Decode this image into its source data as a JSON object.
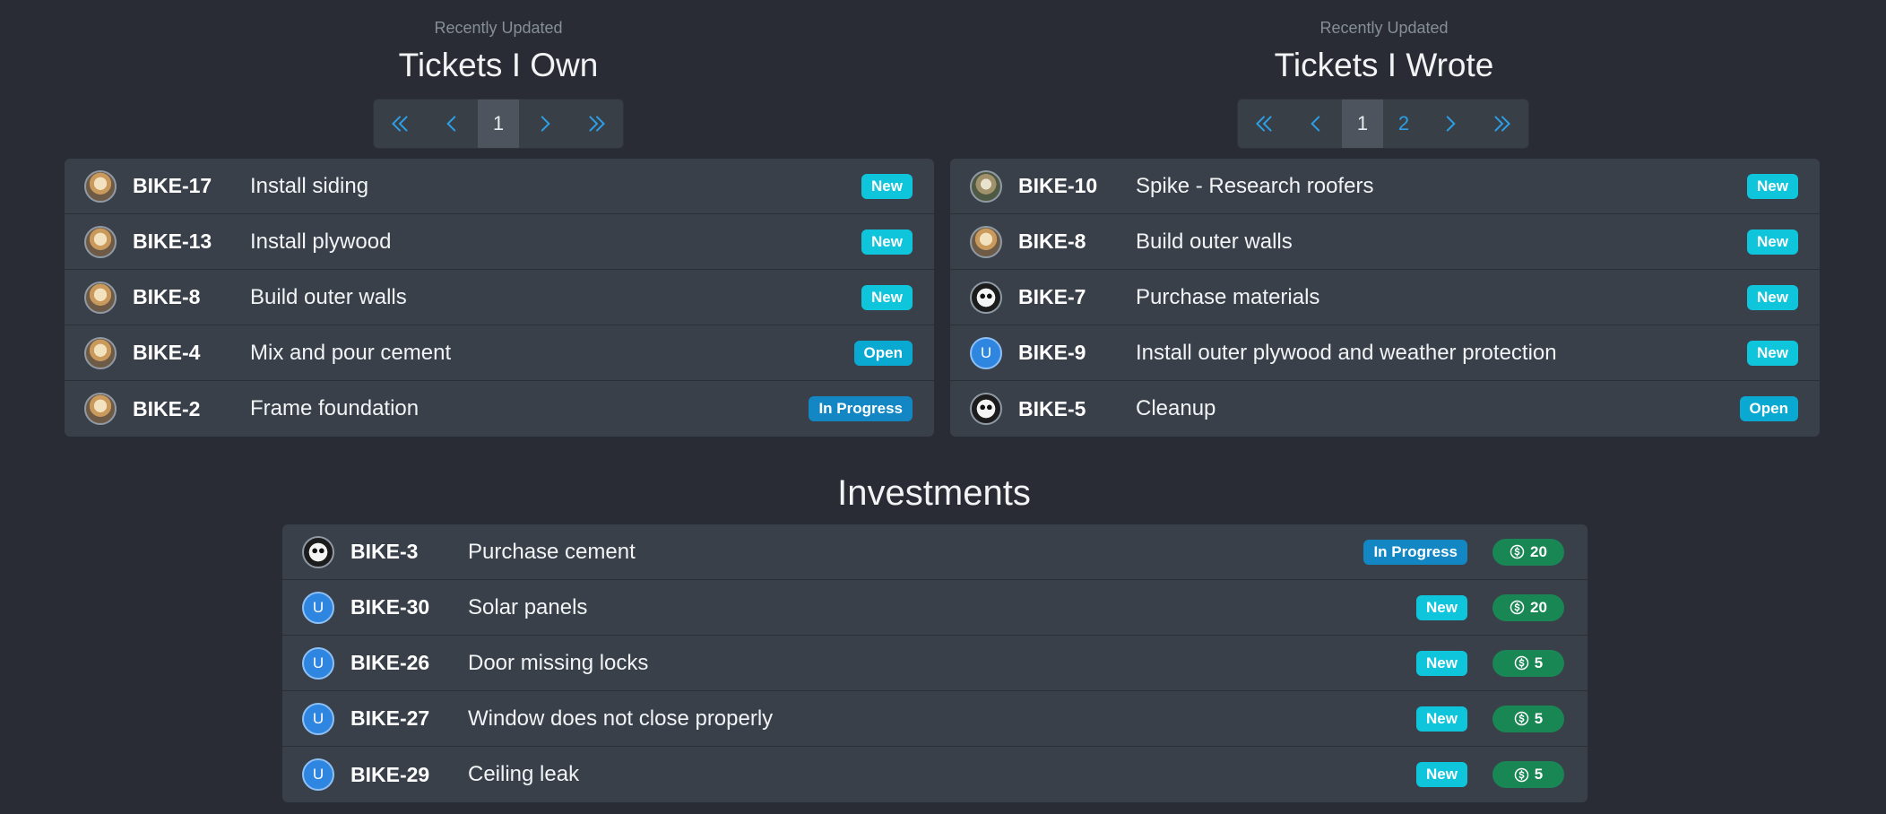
{
  "owned": {
    "subtitle": "Recently Updated",
    "title": "Tickets I Own",
    "pages": [
      "1"
    ],
    "tickets": [
      {
        "avatar": "dog",
        "key": "BIKE-17",
        "summary": "Install siding",
        "status": "New"
      },
      {
        "avatar": "dog",
        "key": "BIKE-13",
        "summary": "Install plywood",
        "status": "New"
      },
      {
        "avatar": "dog",
        "key": "BIKE-8",
        "summary": "Build outer walls",
        "status": "New"
      },
      {
        "avatar": "dog",
        "key": "BIKE-4",
        "summary": "Mix and pour cement",
        "status": "Open"
      },
      {
        "avatar": "dog",
        "key": "BIKE-2",
        "summary": "Frame foundation",
        "status": "In Progress"
      }
    ]
  },
  "wrote": {
    "subtitle": "Recently Updated",
    "title": "Tickets I Wrote",
    "pages": [
      "1",
      "2"
    ],
    "tickets": [
      {
        "avatar": "dog2",
        "key": "BIKE-10",
        "summary": "Spike - Research roofers",
        "status": "New"
      },
      {
        "avatar": "dog",
        "key": "BIKE-8",
        "summary": "Build outer walls",
        "status": "New"
      },
      {
        "avatar": "panda",
        "key": "BIKE-7",
        "summary": "Purchase materials",
        "status": "New"
      },
      {
        "avatar": "letter",
        "letter": "U",
        "key": "BIKE-9",
        "summary": "Install outer plywood and weather protection",
        "status": "New"
      },
      {
        "avatar": "panda",
        "key": "BIKE-5",
        "summary": "Cleanup",
        "status": "Open"
      }
    ]
  },
  "investments": {
    "title": "Investments",
    "tickets": [
      {
        "avatar": "panda",
        "key": "BIKE-3",
        "summary": "Purchase cement",
        "status": "In Progress",
        "amount": "20"
      },
      {
        "avatar": "letter",
        "letter": "U",
        "key": "BIKE-30",
        "summary": "Solar panels",
        "status": "New",
        "amount": "20"
      },
      {
        "avatar": "letter",
        "letter": "U",
        "key": "BIKE-26",
        "summary": "Door missing locks",
        "status": "New",
        "amount": "5"
      },
      {
        "avatar": "letter",
        "letter": "U",
        "key": "BIKE-27",
        "summary": "Window does not close properly",
        "status": "New",
        "amount": "5"
      },
      {
        "avatar": "letter",
        "letter": "U",
        "key": "BIKE-29",
        "summary": "Ceiling leak",
        "status": "New",
        "amount": "5"
      }
    ]
  },
  "colors": {
    "background": "#292c35",
    "card": "#39404a",
    "status_new": "#0ec5dc",
    "status_open": "#0aa9d1",
    "status_in_progress": "#1287c4",
    "investment_badge": "#198754",
    "pager_link": "#2d9fe6"
  },
  "icons": {
    "first": "double-chevron-left-icon",
    "prev": "chevron-left-icon",
    "next": "chevron-right-icon",
    "last": "double-chevron-right-icon",
    "money": "coin-dollar-icon"
  }
}
